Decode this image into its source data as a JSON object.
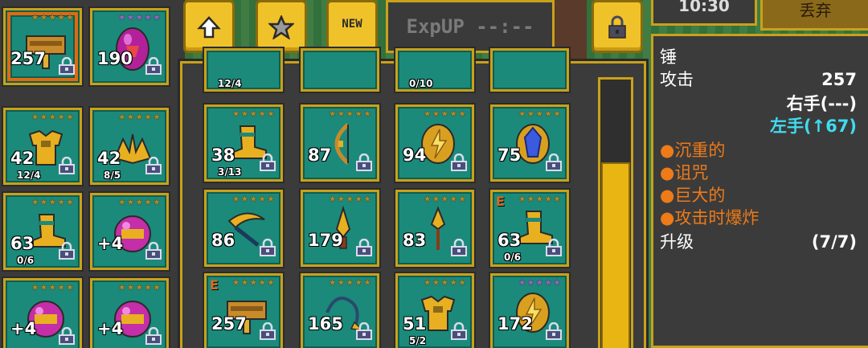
{
  "toolbar": {
    "new_label": "NEW",
    "exp_label": "ExpUP --:--"
  },
  "top_right": {
    "clock": "10:30",
    "discard_label": "丢弃"
  },
  "equipped": [
    {
      "value": "257",
      "sub": "",
      "stars": "★★★★★",
      "icon": "hammer-icon"
    },
    {
      "value": "190",
      "sub": "",
      "stars": "★★★★★",
      "icon": "purple-gem-icon"
    },
    {
      "value": "42",
      "sub": "12/4",
      "stars": "★★★★★",
      "icon": "gold-armor-icon"
    },
    {
      "value": "42",
      "sub": "8/5",
      "stars": "★★★★★",
      "icon": "gold-helmet-icon"
    },
    {
      "value": "63",
      "sub": "0/6",
      "stars": "★★★★★",
      "icon": "gold-boot-icon"
    },
    {
      "value": "+4",
      "sub": "",
      "stars": "★★★★★",
      "icon": "pink-orb-icon"
    },
    {
      "value": "+4",
      "sub": "",
      "stars": "★★★★★",
      "icon": "pink-orb-icon"
    },
    {
      "value": "+4",
      "sub": "",
      "stars": "★★★★★",
      "icon": "pink-orb-icon"
    }
  ],
  "inventory_top_partial": [
    "12/4",
    "",
    "0/10",
    ""
  ],
  "inventory": [
    {
      "value": "38",
      "sub": "3/13",
      "stars": "★★★★★",
      "icon": "gold-boot-icon"
    },
    {
      "value": "87",
      "sub": "",
      "stars": "★★★★★",
      "icon": "bow-icon"
    },
    {
      "value": "94",
      "sub": "",
      "stars": "★★★★★",
      "icon": "lightning-gem-icon"
    },
    {
      "value": "75",
      "sub": "",
      "stars": "★★★★★",
      "icon": "blue-gem-icon"
    },
    {
      "value": "86",
      "sub": "",
      "stars": "★★★★★",
      "icon": "scythe-icon"
    },
    {
      "value": "179",
      "sub": "",
      "stars": "★★★★★",
      "icon": "dagger-icon"
    },
    {
      "value": "83",
      "sub": "",
      "stars": "★★★★★",
      "icon": "spear-icon"
    },
    {
      "value": "63",
      "sub": "0/6",
      "stars": "★★★★★",
      "icon": "gold-boot-icon"
    },
    {
      "value": "257",
      "sub": "",
      "stars": "★★★★★",
      "icon": "hammer-icon"
    },
    {
      "value": "165",
      "sub": "",
      "stars": "★★★★★",
      "icon": "whip-icon"
    },
    {
      "value": "51",
      "sub": "5/2",
      "stars": "★★★★★",
      "icon": "gold-armor-icon"
    },
    {
      "value": "172",
      "sub": "",
      "stars": "★★★★★",
      "icon": "lightning-gem-icon"
    }
  ],
  "details": {
    "name": "锤",
    "attack_label": "攻击",
    "attack_value": "257",
    "right_hand": "右手(---)",
    "left_hand": "左手(↑67)",
    "traits": [
      "●沉重的",
      "●诅咒",
      "●巨大的",
      "●攻击时爆炸"
    ],
    "upgrade_label": "升级",
    "upgrade_value": "(7/7)"
  },
  "colors": {
    "slot_bg": "#1b8a7a",
    "frame_gold": "#c9a11a",
    "selected_orange": "#e06a10",
    "trait_orange": "#ee7a18",
    "left_hand_cyan": "#3fdcf0"
  }
}
